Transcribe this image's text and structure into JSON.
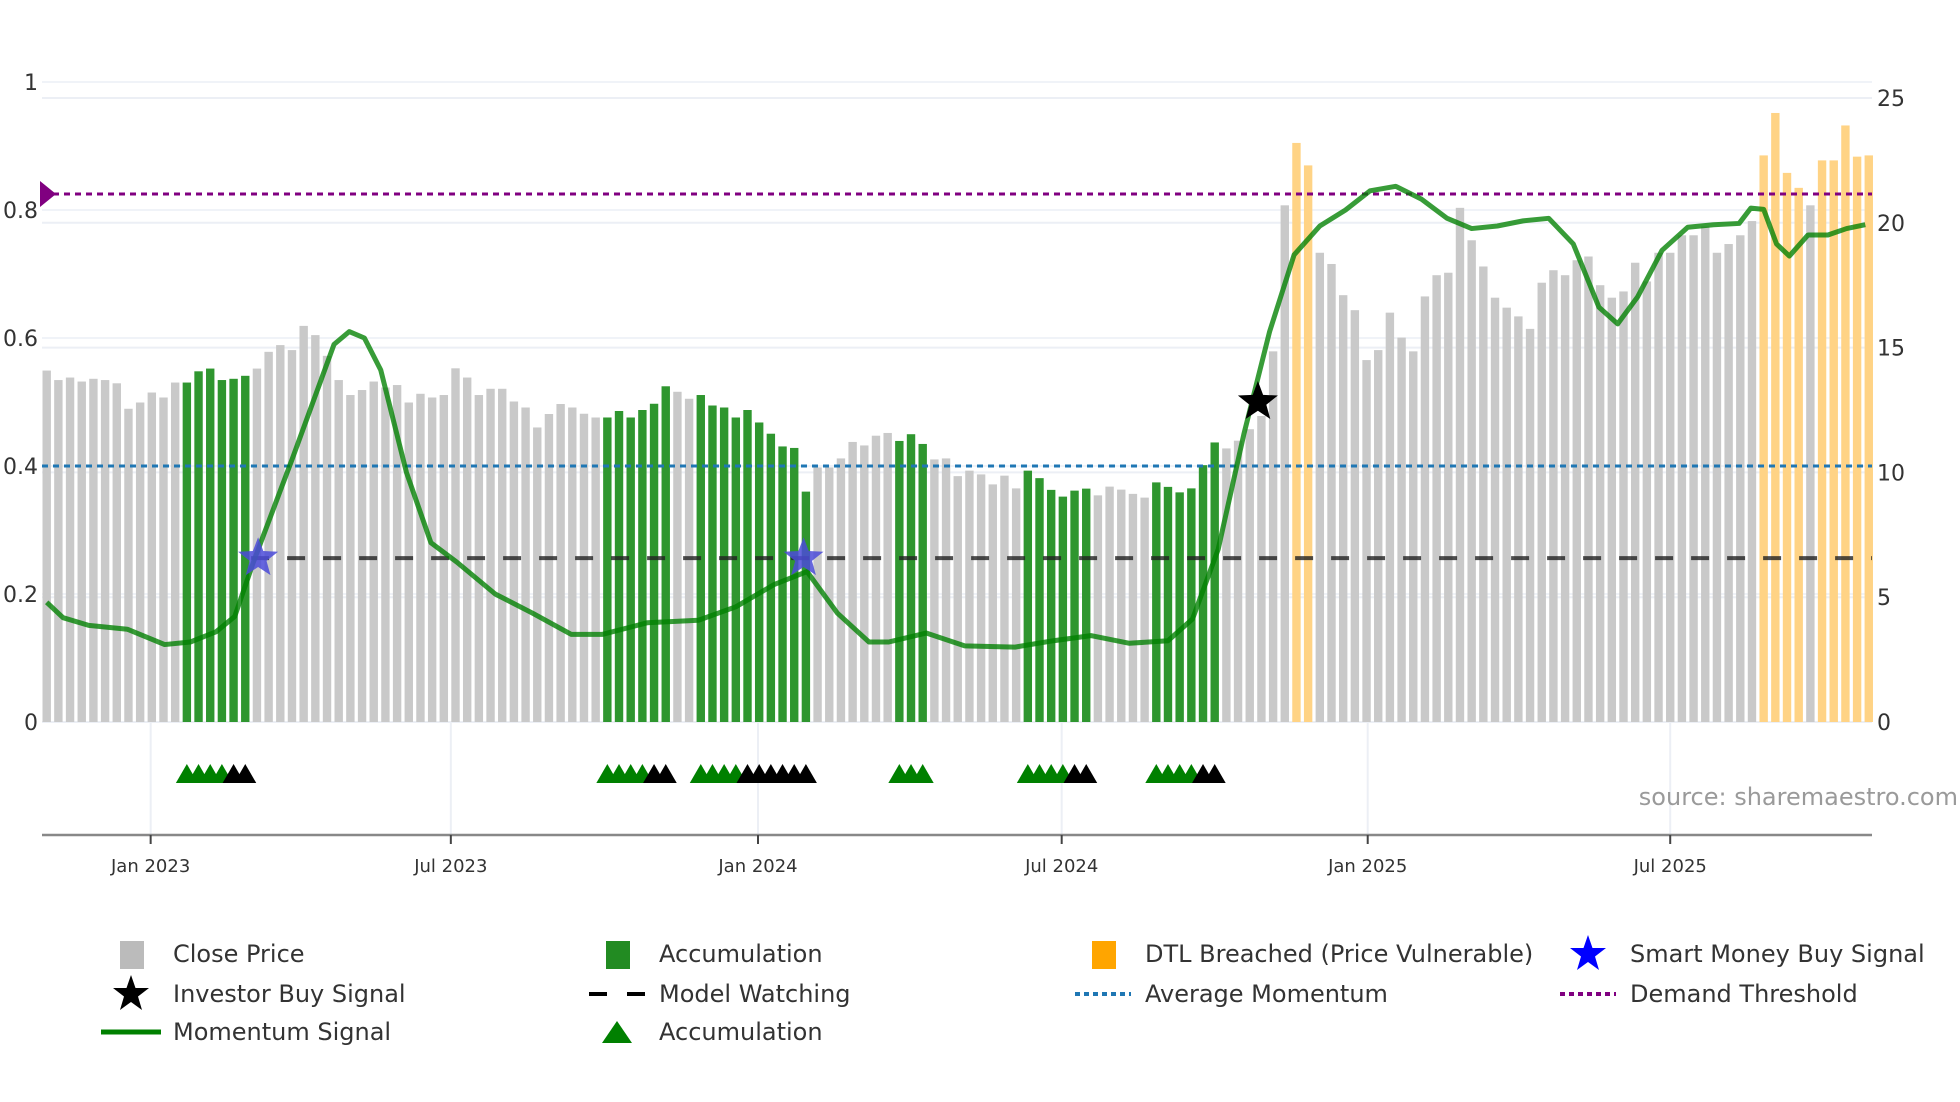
{
  "chart_data": {
    "type": "bar",
    "x_unit": "week index",
    "left_axis": {
      "range": [
        0,
        1
      ],
      "ticks": [
        0,
        0.2,
        0.4,
        0.6,
        0.8,
        1
      ],
      "tick_labels": [
        "0",
        "0.2",
        "0.4",
        "0.6",
        "0.8",
        "1"
      ]
    },
    "right_axis": {
      "range": [
        0,
        25
      ],
      "ticks": [
        0,
        5,
        10,
        15,
        20,
        25
      ],
      "tick_labels": [
        "0",
        "5",
        "10",
        "15",
        "20",
        "25"
      ]
    },
    "x_ticks": [
      {
        "label": "Jan 2023",
        "week": 8.9
      },
      {
        "label": "Jul 2023",
        "week": 34.6
      },
      {
        "label": "Jan 2024",
        "week": 60.9
      },
      {
        "label": "Jul 2024",
        "week": 86.9
      },
      {
        "label": "Jan 2025",
        "week": 113.1
      },
      {
        "label": "Jul 2025",
        "week": 139.0
      }
    ],
    "close_price": [
      14.08,
      13.7,
      13.8,
      13.64,
      13.75,
      13.7,
      13.57,
      12.55,
      12.8,
      13.2,
      13.0,
      13.6,
      13.6,
      14.05,
      14.16,
      13.7,
      13.75,
      13.87,
      14.16,
      14.83,
      15.1,
      14.9,
      15.87,
      15.5,
      14.67,
      13.7,
      13.1,
      13.3,
      13.64,
      13.4,
      13.5,
      12.8,
      13.15,
      13.0,
      13.1,
      14.17,
      13.8,
      13.1,
      13.35,
      13.35,
      12.84,
      12.6,
      11.8,
      12.34,
      12.74,
      12.6,
      12.35,
      12.2,
      12.2,
      12.46,
      12.2,
      12.5,
      12.75,
      13.45,
      13.23,
      12.95,
      13.1,
      12.68,
      12.6,
      12.2,
      12.5,
      12.0,
      11.55,
      11.04,
      10.98,
      9.23,
      10.2,
      10.2,
      10.56,
      11.22,
      11.08,
      11.47,
      11.58,
      11.26,
      11.53,
      11.14,
      10.52,
      10.56,
      9.85,
      10.07,
      9.92,
      9.52,
      9.87,
      9.36,
      10.07,
      9.77,
      9.3,
      9.03,
      9.27,
      9.35,
      9.08,
      9.43,
      9.31,
      9.14,
      8.99,
      9.6,
      9.42,
      9.2,
      9.36,
      10.29,
      11.2,
      10.96,
      11.27,
      11.73,
      12.26,
      14.85,
      20.7,
      23.2,
      22.3,
      18.8,
      18.35,
      17.1,
      16.5,
      14.5,
      14.9,
      16.4,
      15.4,
      14.85,
      17.05,
      17.9,
      18.0,
      20.6,
      19.3,
      18.25,
      17.0,
      16.6,
      16.25,
      15.75,
      17.6,
      18.1,
      17.9,
      18.5,
      18.65,
      17.5,
      17.0,
      17.25,
      18.4,
      17.65,
      18.8,
      18.8,
      19.5,
      19.5,
      19.85,
      18.8,
      19.15,
      19.5,
      20.07,
      22.7,
      24.4,
      22.0,
      21.4,
      20.7,
      22.5,
      22.5,
      23.9,
      22.65,
      22.7
    ],
    "accumulation_bars": [
      12,
      13,
      14,
      15,
      16,
      17,
      48,
      49,
      50,
      51,
      52,
      53,
      56,
      57,
      58,
      59,
      60,
      61,
      62,
      63,
      64,
      65,
      73,
      74,
      75,
      84,
      85,
      86,
      87,
      88,
      89,
      95,
      96,
      97,
      98,
      99,
      100
    ],
    "dtl_breached_bars": [
      107,
      108,
      147,
      148,
      149,
      150,
      152,
      153,
      154,
      155,
      156
    ],
    "momentum_signal": [
      [
        0,
        0.187
      ],
      [
        1.4,
        0.163
      ],
      [
        3.6,
        0.151
      ],
      [
        6.9,
        0.145
      ],
      [
        10.1,
        0.121
      ],
      [
        12.3,
        0.125
      ],
      [
        14.5,
        0.141
      ],
      [
        16.1,
        0.165
      ],
      [
        17.7,
        0.25
      ],
      [
        21.0,
        0.41
      ],
      [
        24.6,
        0.59
      ],
      [
        25.9,
        0.61
      ],
      [
        27.2,
        0.6
      ],
      [
        28.6,
        0.55
      ],
      [
        30.8,
        0.39
      ],
      [
        32.9,
        0.28
      ],
      [
        35.1,
        0.25
      ],
      [
        38.4,
        0.2
      ],
      [
        41.6,
        0.17
      ],
      [
        44.9,
        0.137
      ],
      [
        47.6,
        0.137
      ],
      [
        51.4,
        0.155
      ],
      [
        55.8,
        0.159
      ],
      [
        59.0,
        0.18
      ],
      [
        62.3,
        0.215
      ],
      [
        65.1,
        0.235
      ],
      [
        67.7,
        0.17
      ],
      [
        70.4,
        0.125
      ],
      [
        72.1,
        0.125
      ],
      [
        75.3,
        0.139
      ],
      [
        78.6,
        0.119
      ],
      [
        82.9,
        0.117
      ],
      [
        86.2,
        0.127
      ],
      [
        89.4,
        0.135
      ],
      [
        92.7,
        0.123
      ],
      [
        96.0,
        0.127
      ],
      [
        98.1,
        0.161
      ],
      [
        100.3,
        0.27
      ],
      [
        102.5,
        0.45
      ],
      [
        104.7,
        0.61
      ],
      [
        106.8,
        0.73
      ],
      [
        109.0,
        0.775
      ],
      [
        111.2,
        0.8
      ],
      [
        113.3,
        0.83
      ],
      [
        115.5,
        0.837
      ],
      [
        117.7,
        0.817
      ],
      [
        119.9,
        0.787
      ],
      [
        122.0,
        0.771
      ],
      [
        124.2,
        0.775
      ],
      [
        126.4,
        0.783
      ],
      [
        128.6,
        0.787
      ],
      [
        130.7,
        0.747
      ],
      [
        132.9,
        0.648
      ],
      [
        134.5,
        0.622
      ],
      [
        136.2,
        0.664
      ],
      [
        138.3,
        0.737
      ],
      [
        140.5,
        0.773
      ],
      [
        142.7,
        0.777
      ],
      [
        144.9,
        0.779
      ],
      [
        145.9,
        0.803
      ],
      [
        147.0,
        0.801
      ],
      [
        148.1,
        0.747
      ],
      [
        149.2,
        0.728
      ],
      [
        150.8,
        0.761
      ],
      [
        152.5,
        0.761
      ],
      [
        154.1,
        0.771
      ],
      [
        155.7,
        0.777
      ]
    ],
    "average_momentum": 0.4,
    "demand_threshold": 0.825,
    "model_watching": {
      "value": 0.256,
      "from_week": 17.5
    },
    "smart_money_buy_signals": [
      {
        "week": 18.1,
        "value": 0.256
      },
      {
        "week": 64.8,
        "value": 0.256
      }
    ],
    "investor_buy_signals": [
      {
        "week": 103.7,
        "value": 0.5
      }
    ],
    "accumulation_markers_green": [
      12,
      13,
      14,
      15,
      48,
      49,
      50,
      51,
      56,
      57,
      58,
      59,
      73,
      74,
      75,
      84,
      85,
      86,
      87,
      95,
      96,
      97,
      98
    ],
    "accumulation_markers_black": [
      16,
      17,
      52,
      53,
      60,
      61,
      62,
      63,
      64,
      65,
      88,
      89,
      99,
      100
    ],
    "source": "source: sharemaestro.com",
    "legend": [
      {
        "label": "Close Price",
        "marker": "square",
        "color": "#bbbbbb"
      },
      {
        "label": "Accumulation",
        "marker": "square",
        "color": "#228b22"
      },
      {
        "label": "DTL Breached (Price Vulnerable)",
        "marker": "square",
        "color": "#ffa500"
      },
      {
        "label": "Smart Money Buy Signal",
        "marker": "star",
        "color": "#0000ff"
      },
      {
        "label": "Investor Buy Signal",
        "marker": "star",
        "color": "#000000"
      },
      {
        "label": "Model Watching",
        "marker": "dash",
        "color": "#000000"
      },
      {
        "label": "Average Momentum",
        "marker": "dot",
        "color": "#1f77b4"
      },
      {
        "label": "Demand Threshold",
        "marker": "dot",
        "color": "#800080"
      },
      {
        "label": "Momentum Signal",
        "marker": "line",
        "color": "#008000"
      },
      {
        "label": "Accumulation",
        "marker": "triangle",
        "color": "#008000"
      }
    ],
    "colors": {
      "price": "#c9c9c9",
      "accumulation": "#2f962f",
      "dtl": "#ffd385",
      "momentum": "#008000",
      "avg": "#1f77b4",
      "demand": "#800080",
      "smart_star": "#4b4bd8",
      "grid": "#eceff5"
    }
  }
}
